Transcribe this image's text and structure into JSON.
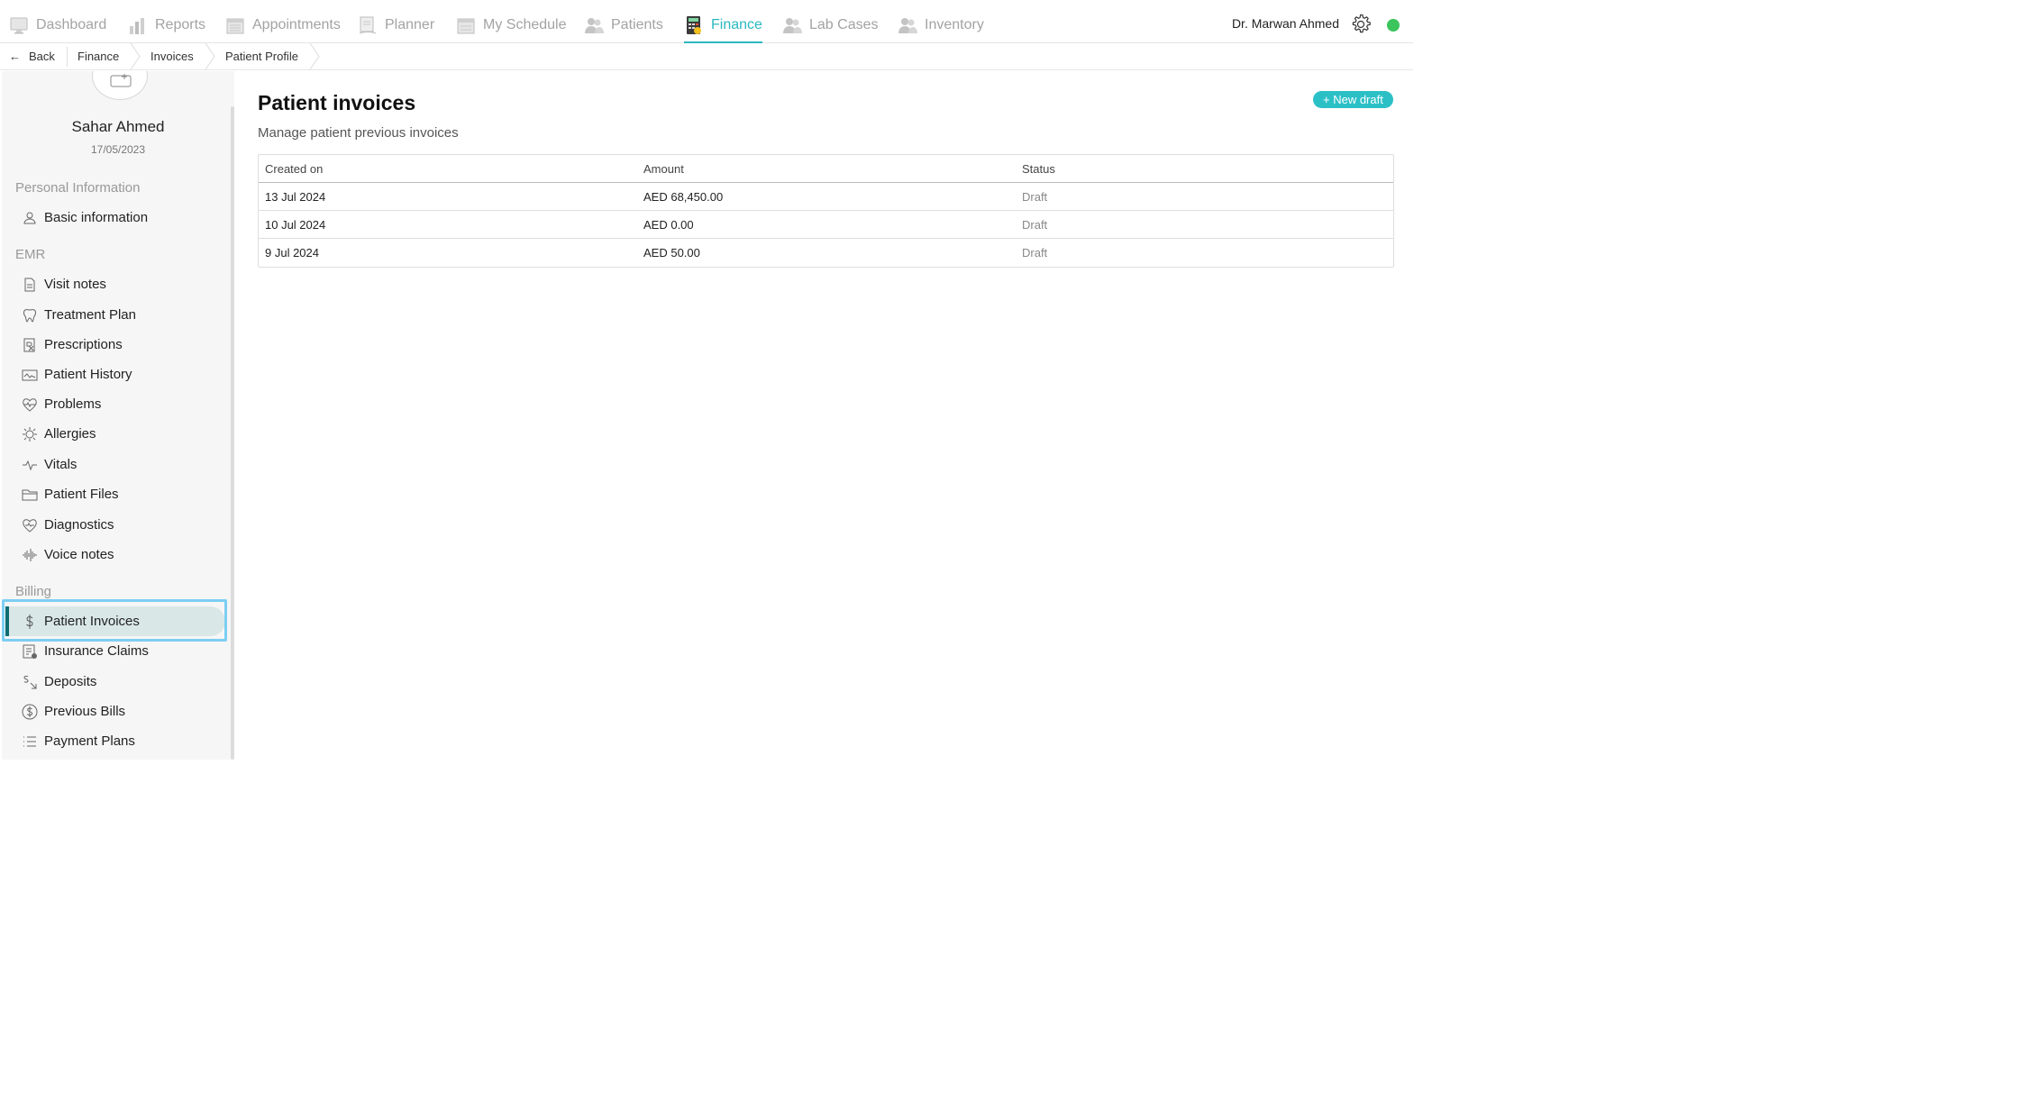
{
  "nav": {
    "items": [
      {
        "label": "Dashboard",
        "icon": "monitor-icon"
      },
      {
        "label": "Reports",
        "icon": "bar-chart-icon"
      },
      {
        "label": "Appointments",
        "icon": "calendar-icon"
      },
      {
        "label": "Planner",
        "icon": "planner-icon"
      },
      {
        "label": "My Schedule",
        "icon": "schedule-icon"
      },
      {
        "label": "Patients",
        "icon": "users-icon"
      },
      {
        "label": "Finance",
        "icon": "calculator-icon"
      },
      {
        "label": "Lab Cases",
        "icon": "users-icon"
      },
      {
        "label": "Inventory",
        "icon": "users-icon"
      }
    ],
    "active": "Finance",
    "user_name": "Dr. Marwan Ahmed",
    "status_color": "#3cc45d",
    "accent_color": "#2bb8c0"
  },
  "breadcrumb": {
    "back": "Back",
    "items": [
      "Finance",
      "Invoices",
      "Patient Profile"
    ]
  },
  "patient": {
    "name": "Sahar Ahmed",
    "date": "17/05/2023"
  },
  "sidebar": {
    "sections": [
      "Personal Information",
      "EMR",
      "Billing"
    ],
    "personal": [
      {
        "label": "Basic information",
        "icon": "person-icon"
      }
    ],
    "emr": [
      {
        "label": "Visit notes",
        "icon": "document-icon"
      },
      {
        "label": "Treatment Plan",
        "icon": "tooth-icon"
      },
      {
        "label": "Prescriptions",
        "icon": "rx-icon"
      },
      {
        "label": "Patient History",
        "icon": "history-icon"
      },
      {
        "label": "Problems",
        "icon": "heartbeat-icon"
      },
      {
        "label": "Allergies",
        "icon": "allergy-icon"
      },
      {
        "label": "Vitals",
        "icon": "pulse-icon"
      },
      {
        "label": "Patient Files",
        "icon": "folder-icon"
      },
      {
        "label": "Diagnostics",
        "icon": "diagnostics-icon"
      },
      {
        "label": "Voice notes",
        "icon": "waveform-icon"
      }
    ],
    "billing": [
      {
        "label": "Patient Invoices",
        "icon": "dollar-icon"
      },
      {
        "label": "Insurance Claims",
        "icon": "claim-icon"
      },
      {
        "label": "Deposits",
        "icon": "deposit-icon"
      },
      {
        "label": "Previous Bills",
        "icon": "dollar-circle-icon"
      },
      {
        "label": "Payment Plans",
        "icon": "list-icon"
      }
    ],
    "active": "Patient Invoices"
  },
  "main": {
    "title": "Patient invoices",
    "subtitle": "Manage patient previous invoices",
    "new_draft_label": "+ New draft",
    "table": {
      "headers": [
        "Created on",
        "Amount",
        "Status"
      ],
      "rows": [
        {
          "created": "13 Jul 2024",
          "amount": "AED 68,450.00",
          "status": "Draft"
        },
        {
          "created": "10 Jul 2024",
          "amount": "AED 0.00",
          "status": "Draft"
        },
        {
          "created": "9 Jul 2024",
          "amount": "AED 50.00",
          "status": "Draft"
        }
      ]
    }
  }
}
